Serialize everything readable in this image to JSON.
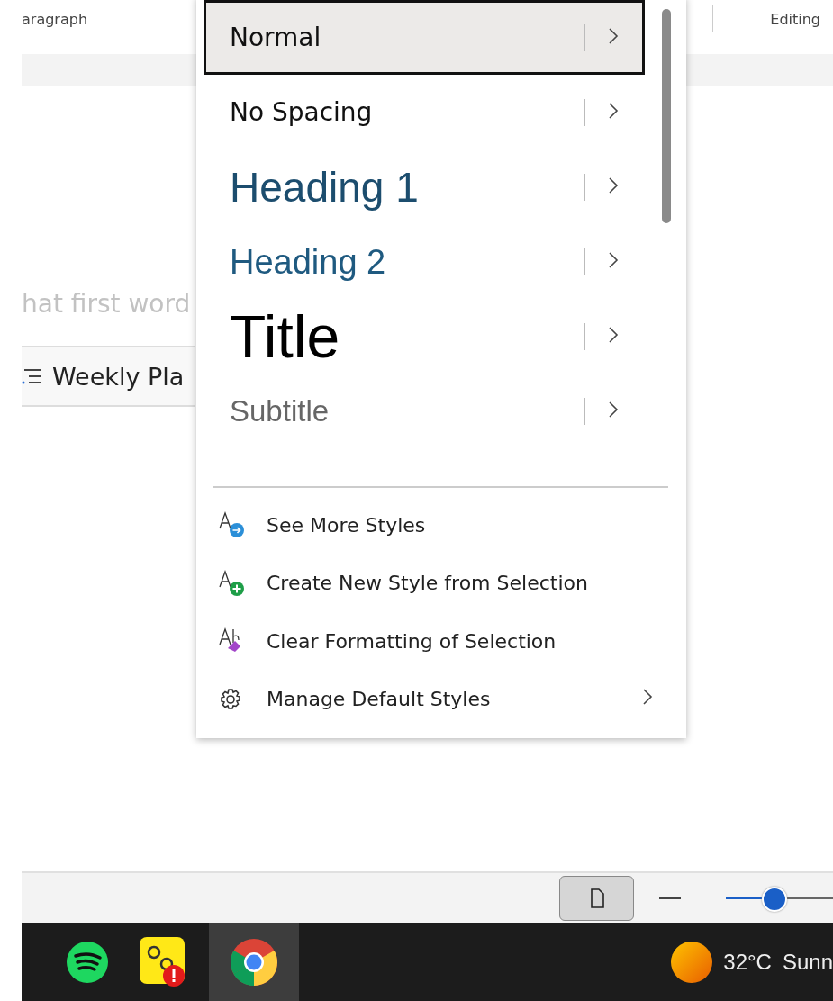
{
  "ribbon": {
    "group_labels": [
      "aragraph",
      "Editing"
    ]
  },
  "document": {
    "hint_text": "hat first word",
    "list_item": "Weekly Pla"
  },
  "styles_menu": {
    "styles": [
      {
        "label": "Normal",
        "kind": "normal",
        "selected": true
      },
      {
        "label": "No Spacing",
        "kind": "normal",
        "selected": false
      },
      {
        "label": "Heading 1",
        "kind": "heading1",
        "selected": false
      },
      {
        "label": "Heading 2",
        "kind": "heading2",
        "selected": false
      },
      {
        "label": "Title",
        "kind": "title",
        "selected": false
      },
      {
        "label": "Subtitle",
        "kind": "subtitle",
        "selected": false
      }
    ],
    "actions": [
      {
        "label": "See More Styles",
        "kind": "see-more",
        "submenu": false
      },
      {
        "label": "Create New Style from Selection",
        "kind": "create",
        "submenu": false
      },
      {
        "label": "Clear Formatting of Selection",
        "kind": "clear",
        "submenu": false
      },
      {
        "label": "Manage Default Styles",
        "kind": "manage",
        "submenu": true
      }
    ]
  },
  "status_bar": {
    "zoom": {
      "level": 0.45
    }
  },
  "taskbar": {
    "apps": [
      {
        "kind": "spotify",
        "selected": false
      },
      {
        "kind": "alert-app",
        "selected": false
      },
      {
        "kind": "chrome",
        "selected": true
      }
    ],
    "temperature": "32°C",
    "condition": "Sunn"
  }
}
